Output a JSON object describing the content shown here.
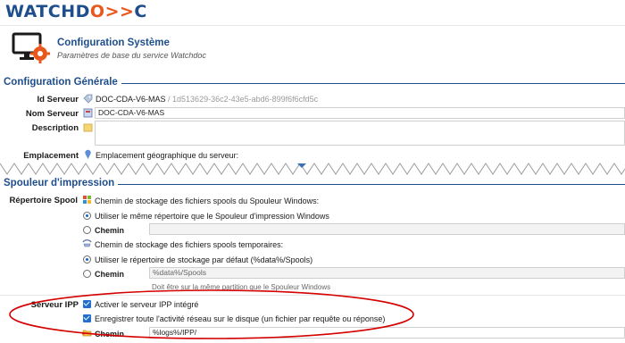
{
  "app": {
    "logo_main": "WATCHD",
    "logo_accent": "O>>",
    "logo_end": "C"
  },
  "header": {
    "title": "Configuration Système",
    "subtitle": "Paramètres de base du service Watchdoc"
  },
  "general": {
    "section_title": "Configuration Générale",
    "id_label": "Id Serveur",
    "id_value": "DOC-CDA-V6-MAS",
    "id_guid": "/ 1d513629-36c2-43e5-abd6-899f6f6cfd5c",
    "name_label": "Nom Serveur",
    "name_value": "DOC-CDA-V6-MAS",
    "description_label": "Description",
    "description_value": "",
    "location_label": "Emplacement",
    "location_text": "Emplacement géographique du serveur:"
  },
  "spooler": {
    "section_title": "Spouleur d'impression",
    "repo_label": "Répertoire Spool",
    "windows_heading": "Chemin de stockage des fichiers spools du Spouleur Windows:",
    "windows_opt_same": "Utiliser le même répertoire que le Spouleur d'impression Windows",
    "windows_opt_path": "Chemin",
    "windows_path_value": "",
    "temp_heading": "Chemin de stockage des fichiers spools temporaires:",
    "temp_opt_default": "Utiliser le répertoire de stockage par défaut (%data%/Spools)",
    "temp_opt_path": "Chemin",
    "temp_path_value": "%data%/Spools",
    "temp_note": "Doit être sur la même partition que le Spouleur Windows"
  },
  "ipp": {
    "label": "Serveur IPP",
    "enable": "Activer le serveur IPP intégré",
    "log_all": "Enregistrer toute l'activité réseau sur le disque (un fichier par requête ou réponse)",
    "path_label": "Chemin",
    "path_value": "%logs%/IPP/"
  },
  "colors": {
    "brand_blue": "#1f4e8c",
    "brand_orange": "#e8581c",
    "highlight": "#d40000",
    "checkbox": "#1e6fd0"
  }
}
